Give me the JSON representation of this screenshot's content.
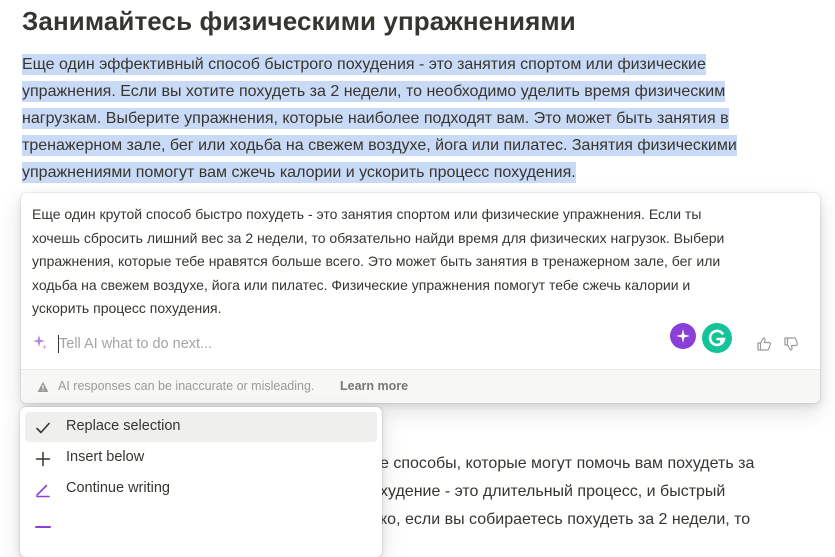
{
  "heading": "Занимайтесь физическими упражнениями",
  "selected_paragraph": [
    "Еще один эффективный способ быстрого похудения - это занятия спортом или физические",
    "упражнения. Если вы хотите похудеть за 2 недели, то необходимо уделить время физическим",
    "нагрузкам. Выберите упражнения, которые наиболее подходят вам. Это может быть занятия в",
    "тренажерном зале, бег или ходьба на свежем воздухе, йога или пилатес. Занятия физическими",
    "упражнениями помогут вам сжечь калории и ускорить процесс похудения."
  ],
  "ai_panel": {
    "result_lines": [
      "Еще один крутой способ быстро похудеть - это занятия спортом или физические упражнения. Если ты",
      "хочешь сбросить лишний вес за 2 недели, то обязательно найди время для физических нагрузок. Выбери",
      "упражнения, которые тебе нравятся больше всего. Это может быть занятия в тренажерном зале, бег или",
      "ходьба на свежем воздухе, йога или пилатес. Физические упражнения помогут тебе сжечь калории и",
      "ускорить процесс похудения."
    ],
    "input_placeholder": "Tell AI what to do next...",
    "input_value": "",
    "disclaimer": "AI responses can be inaccurate or misleading.",
    "learn_more": "Learn more",
    "colors": {
      "purple_badge": "#8b3fd9",
      "grammarly": "#15c39a",
      "selection": "#c9daf6"
    }
  },
  "menu": {
    "items": [
      {
        "label": "Replace selection",
        "icon": "check-icon"
      },
      {
        "label": "Insert below",
        "icon": "plus-icon"
      },
      {
        "label": "Continue writing",
        "icon": "pen-icon"
      }
    ]
  },
  "background_text": [
    "е способы, которые могут помочь вам похудеть за",
    "худение - это длительный процесс, и быстрый",
    "ко, если вы собираетесь похудеть за 2 недели, то"
  ]
}
